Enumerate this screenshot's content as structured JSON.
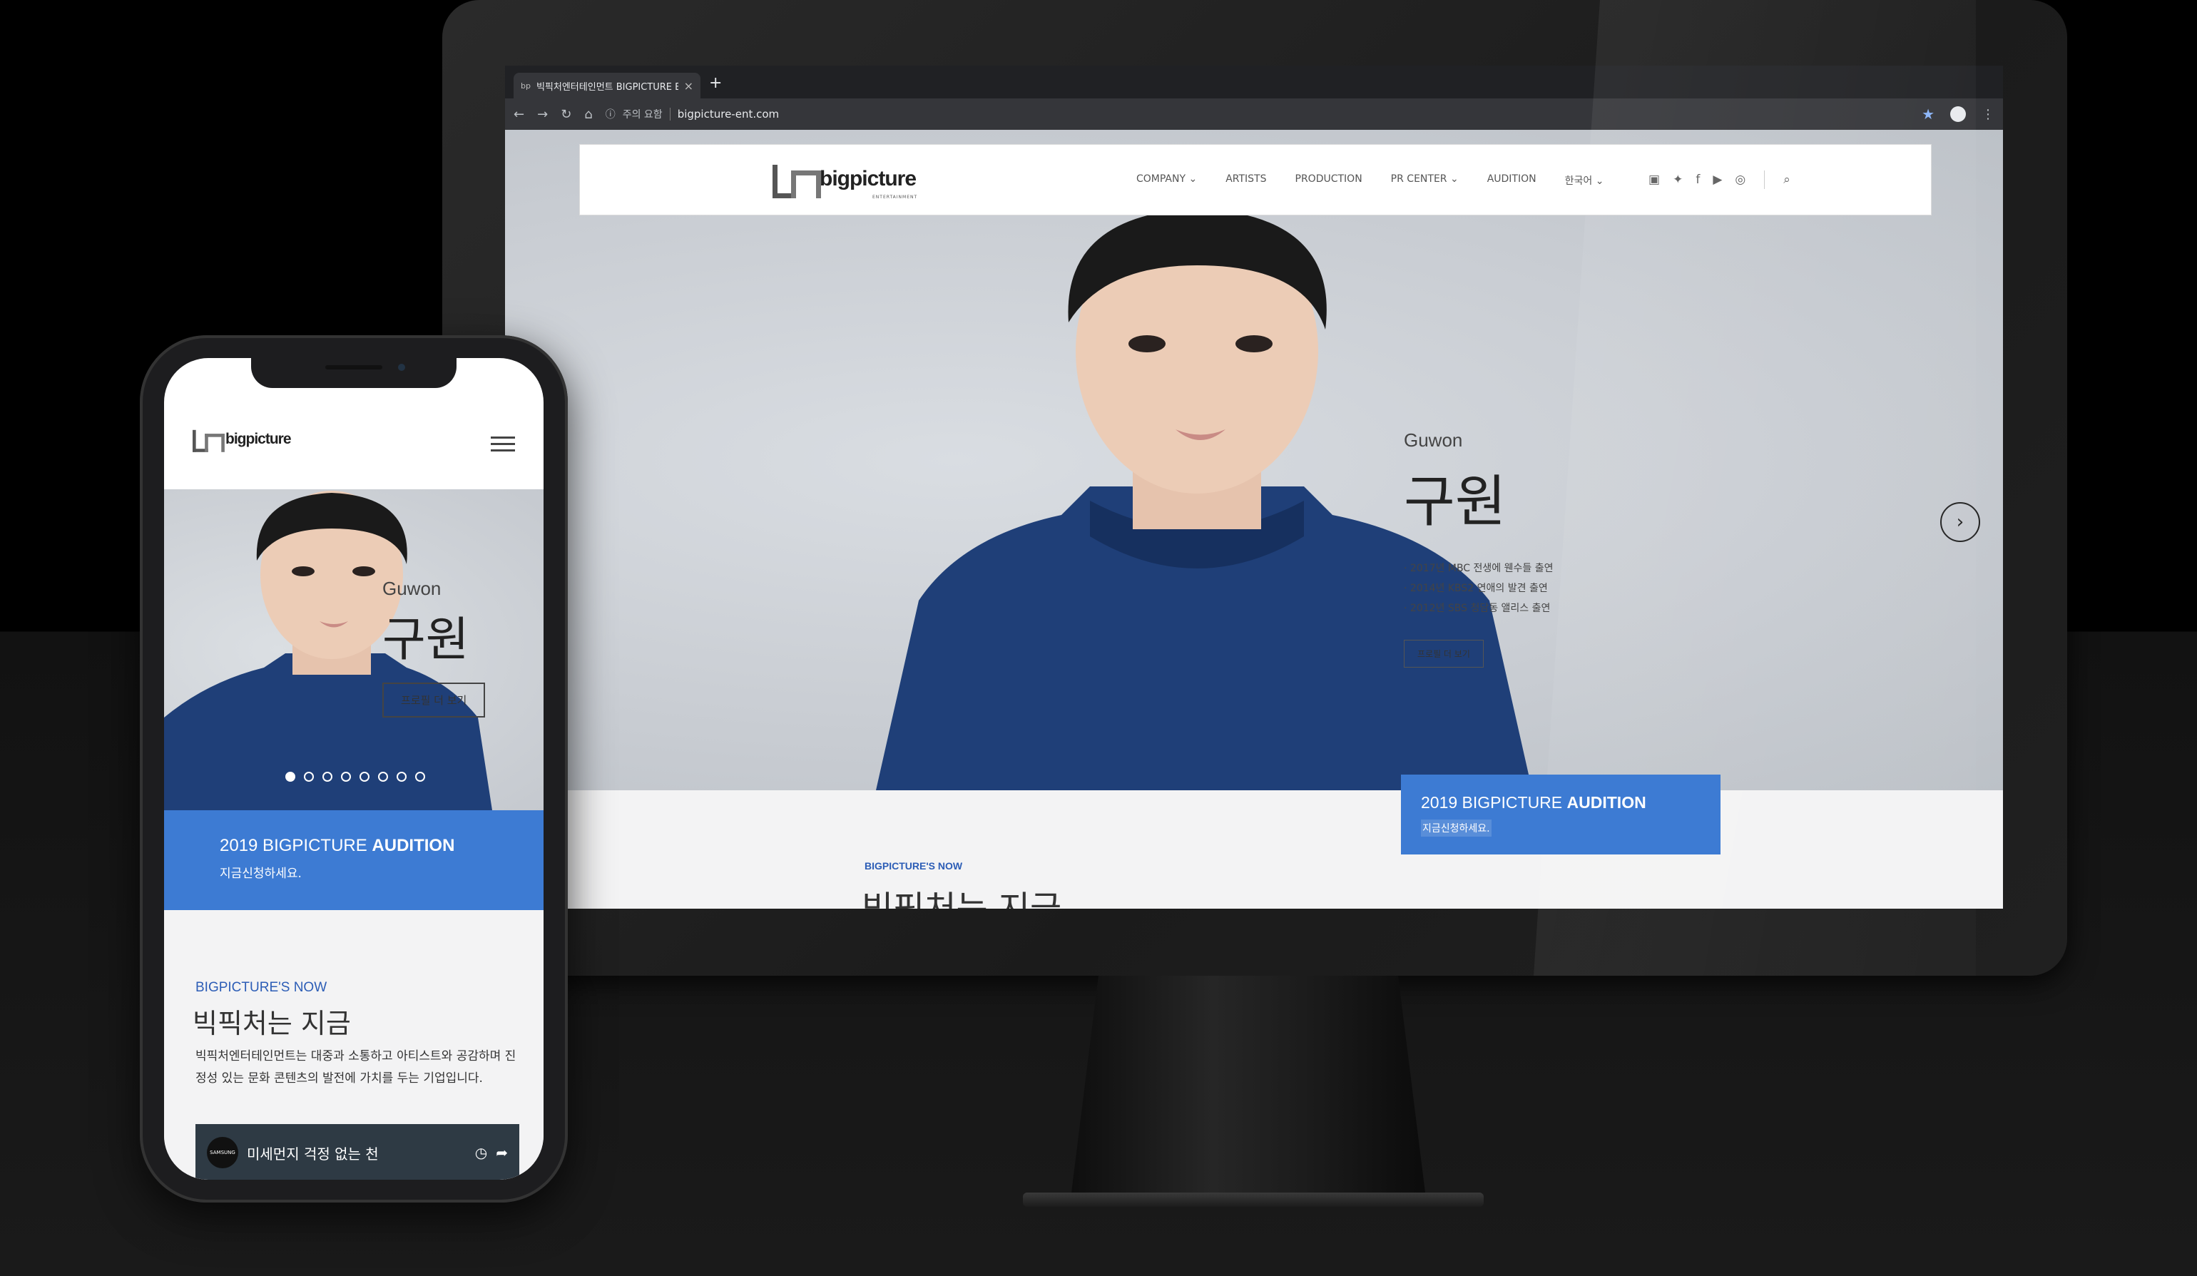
{
  "browser": {
    "tab_title": "빅픽처엔터테인먼트 BIGPICTURE E",
    "tab_favicon": "bp",
    "new_tab": "+",
    "security_label": "주의 요함",
    "url": "bigpicture-ent.com"
  },
  "site": {
    "logo_text": "bigpicture",
    "logo_sub": "ENTERTAINMENT",
    "nav": [
      "COMPANY ⌄",
      "ARTISTS",
      "PRODUCTION",
      "PR CENTER ⌄",
      "AUDITION",
      "한국어 ⌄"
    ],
    "social_icons": [
      "naver-icon",
      "twitter-icon",
      "facebook-icon",
      "youtube-icon",
      "instagram-icon",
      "search-icon"
    ],
    "hero": {
      "name_en": "Guwon",
      "name_ko": "구원",
      "credits": [
        "2017년 MBC 전생에 웬수들 출연",
        "2014년 KBS2 연애의 발견 출연",
        "2012년 SBS 청담동 앨리스 출연"
      ],
      "profile_button": "프로필 더 보기",
      "slide_count": 8,
      "active_slide": 1
    },
    "audition": {
      "title_prefix": "2019 BIGPICTURE ",
      "title_bold": "AUDITION",
      "subtitle": "지금신청하세요."
    },
    "now": {
      "label": "BIGPICTURE'S NOW",
      "title": "빅픽처는 지금",
      "description": "빅픽처엔터테인먼트는 대중과 소통하고 아티스트와 공감하며 진정성 있는 문화 콘텐츠의 발전에 가치를 두는 기업입니다."
    }
  },
  "mobile": {
    "video": {
      "channel": "SAMSUNG",
      "title": "미세먼지 걱정 없는 천"
    }
  },
  "colors": {
    "accent_blue": "#3d7bd3",
    "label_blue": "#2c5db6",
    "browser_dark": "#202124"
  }
}
